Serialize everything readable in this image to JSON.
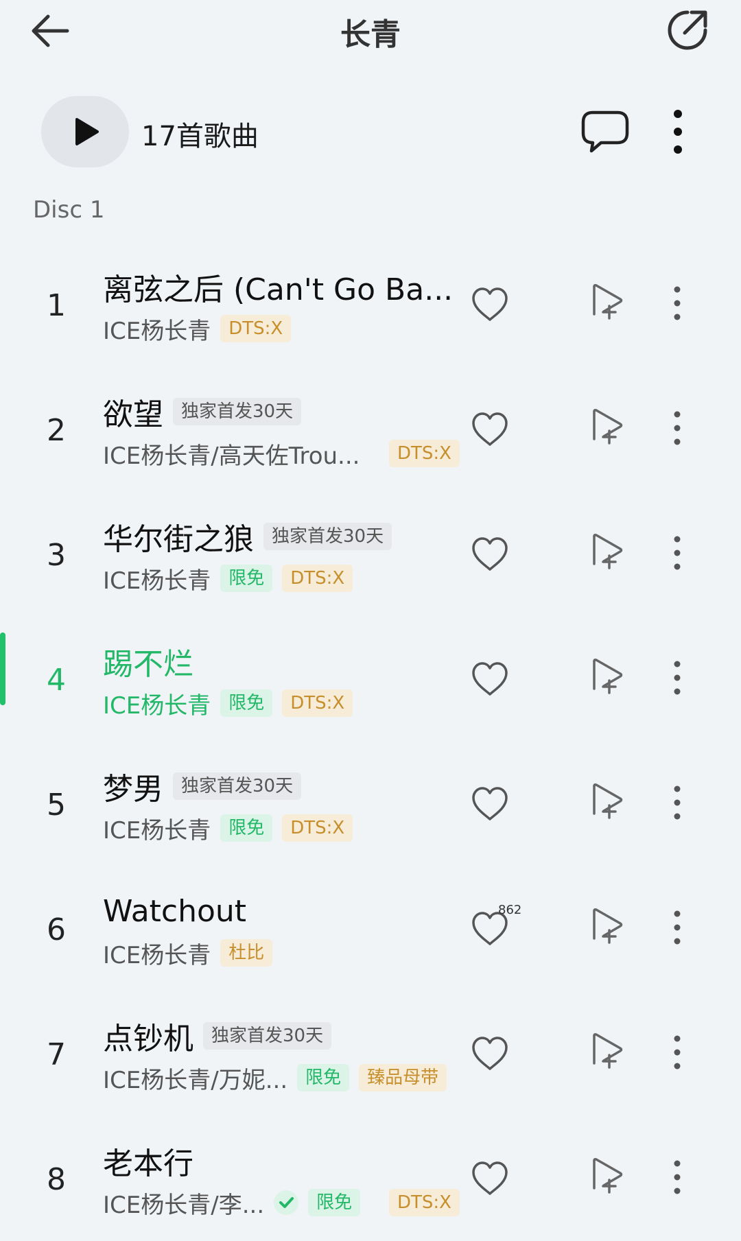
{
  "header": {
    "title": "长青",
    "back_icon": "arrow-left-icon",
    "share_icon": "share-external-icon"
  },
  "toolbar": {
    "song_count": "17首歌曲",
    "play_icon": "play-icon",
    "comment_icon": "comment-bubble-icon",
    "more_icon": "more-vertical-icon"
  },
  "disc_label": "Disc 1",
  "colors": {
    "background": "#f0f4f7",
    "accent_green": "#22b868",
    "dts_gold": "#c78f2c",
    "tag_gray_bg": "#e6e8eb"
  },
  "songs": [
    {
      "num": "1",
      "title": "离弦之后 (Can't Go Ba...",
      "artist": "ICE杨长青",
      "title_tags": [],
      "sub_tags": [
        {
          "text": "DTS:X",
          "kind": "dts"
        }
      ],
      "heart_count": ""
    },
    {
      "num": "2",
      "title": "欲望",
      "artist": "ICE杨长青/高天佐Trou...",
      "title_tags": [
        {
          "text": "独家首发30天",
          "kind": "excl"
        }
      ],
      "sub_tags": [
        {
          "text": "DTS:X",
          "kind": "dts"
        }
      ],
      "heart_count": ""
    },
    {
      "num": "3",
      "title": "华尔街之狼",
      "artist": "ICE杨长青",
      "title_tags": [
        {
          "text": "独家首发30天",
          "kind": "excl"
        }
      ],
      "sub_tags": [
        {
          "text": "限免",
          "kind": "free"
        },
        {
          "text": "DTS:X",
          "kind": "dts"
        }
      ],
      "heart_count": ""
    },
    {
      "num": "4",
      "title": "踢不烂",
      "artist": "ICE杨长青",
      "title_tags": [],
      "sub_tags": [
        {
          "text": "限免",
          "kind": "free"
        },
        {
          "text": "DTS:X",
          "kind": "dts"
        }
      ],
      "heart_count": "",
      "current": true
    },
    {
      "num": "5",
      "title": "梦男",
      "artist": "ICE杨长青",
      "title_tags": [
        {
          "text": "独家首发30天",
          "kind": "excl"
        }
      ],
      "sub_tags": [
        {
          "text": "限免",
          "kind": "free"
        },
        {
          "text": "DTS:X",
          "kind": "dts"
        }
      ],
      "heart_count": ""
    },
    {
      "num": "6",
      "title": "Watchout",
      "artist": "ICE杨长青",
      "title_tags": [],
      "sub_tags": [
        {
          "text": "杜比",
          "kind": "dolby"
        }
      ],
      "heart_count": "862"
    },
    {
      "num": "7",
      "title": "点钞机",
      "artist": "ICE杨长青/万妮...",
      "title_tags": [
        {
          "text": "独家首发30天",
          "kind": "excl"
        }
      ],
      "sub_tags": [
        {
          "text": "限免",
          "kind": "free"
        },
        {
          "text": "臻品母带",
          "kind": "master"
        }
      ],
      "heart_count": ""
    },
    {
      "num": "8",
      "title": "老本行",
      "artist": "ICE杨长青/李...",
      "title_tags": [],
      "sub_tags": [
        {
          "text": "check",
          "kind": "check"
        },
        {
          "text": "限免",
          "kind": "free"
        },
        {
          "text": "DTS:X",
          "kind": "dts"
        }
      ],
      "heart_count": ""
    }
  ],
  "row_icons": {
    "heart": "heart-outline-icon",
    "add": "add-to-playlist-icon",
    "more": "more-vertical-icon"
  }
}
